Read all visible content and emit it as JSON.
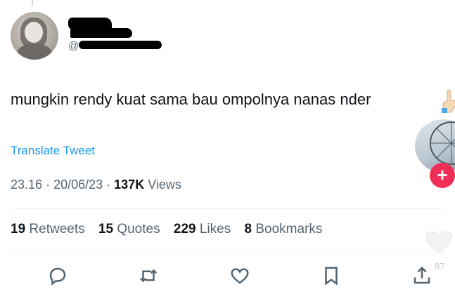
{
  "tweet": {
    "handle_prefix": "@",
    "text": "mungkin rendy kuat sama bau ompolnya nanas nder",
    "translate_label": "Translate Tweet",
    "time": "23.16",
    "date": "20/06/23",
    "views_count": "137K",
    "views_label": "Views"
  },
  "stats": [
    {
      "count": "19",
      "label": "Retweets"
    },
    {
      "count": "15",
      "label": "Quotes"
    },
    {
      "count": "229",
      "label": "Likes"
    },
    {
      "count": "8",
      "label": "Bookmarks"
    }
  ],
  "overlay": {
    "plus_label": "+",
    "side_count": "87"
  },
  "icons": [
    "reply-icon",
    "retweet-icon",
    "like-icon",
    "bookmark-icon",
    "share-icon"
  ],
  "colors": {
    "link": "#1d9bf0",
    "text": "#0f1419",
    "muted": "#536471",
    "plus_button": "#f02e56"
  }
}
